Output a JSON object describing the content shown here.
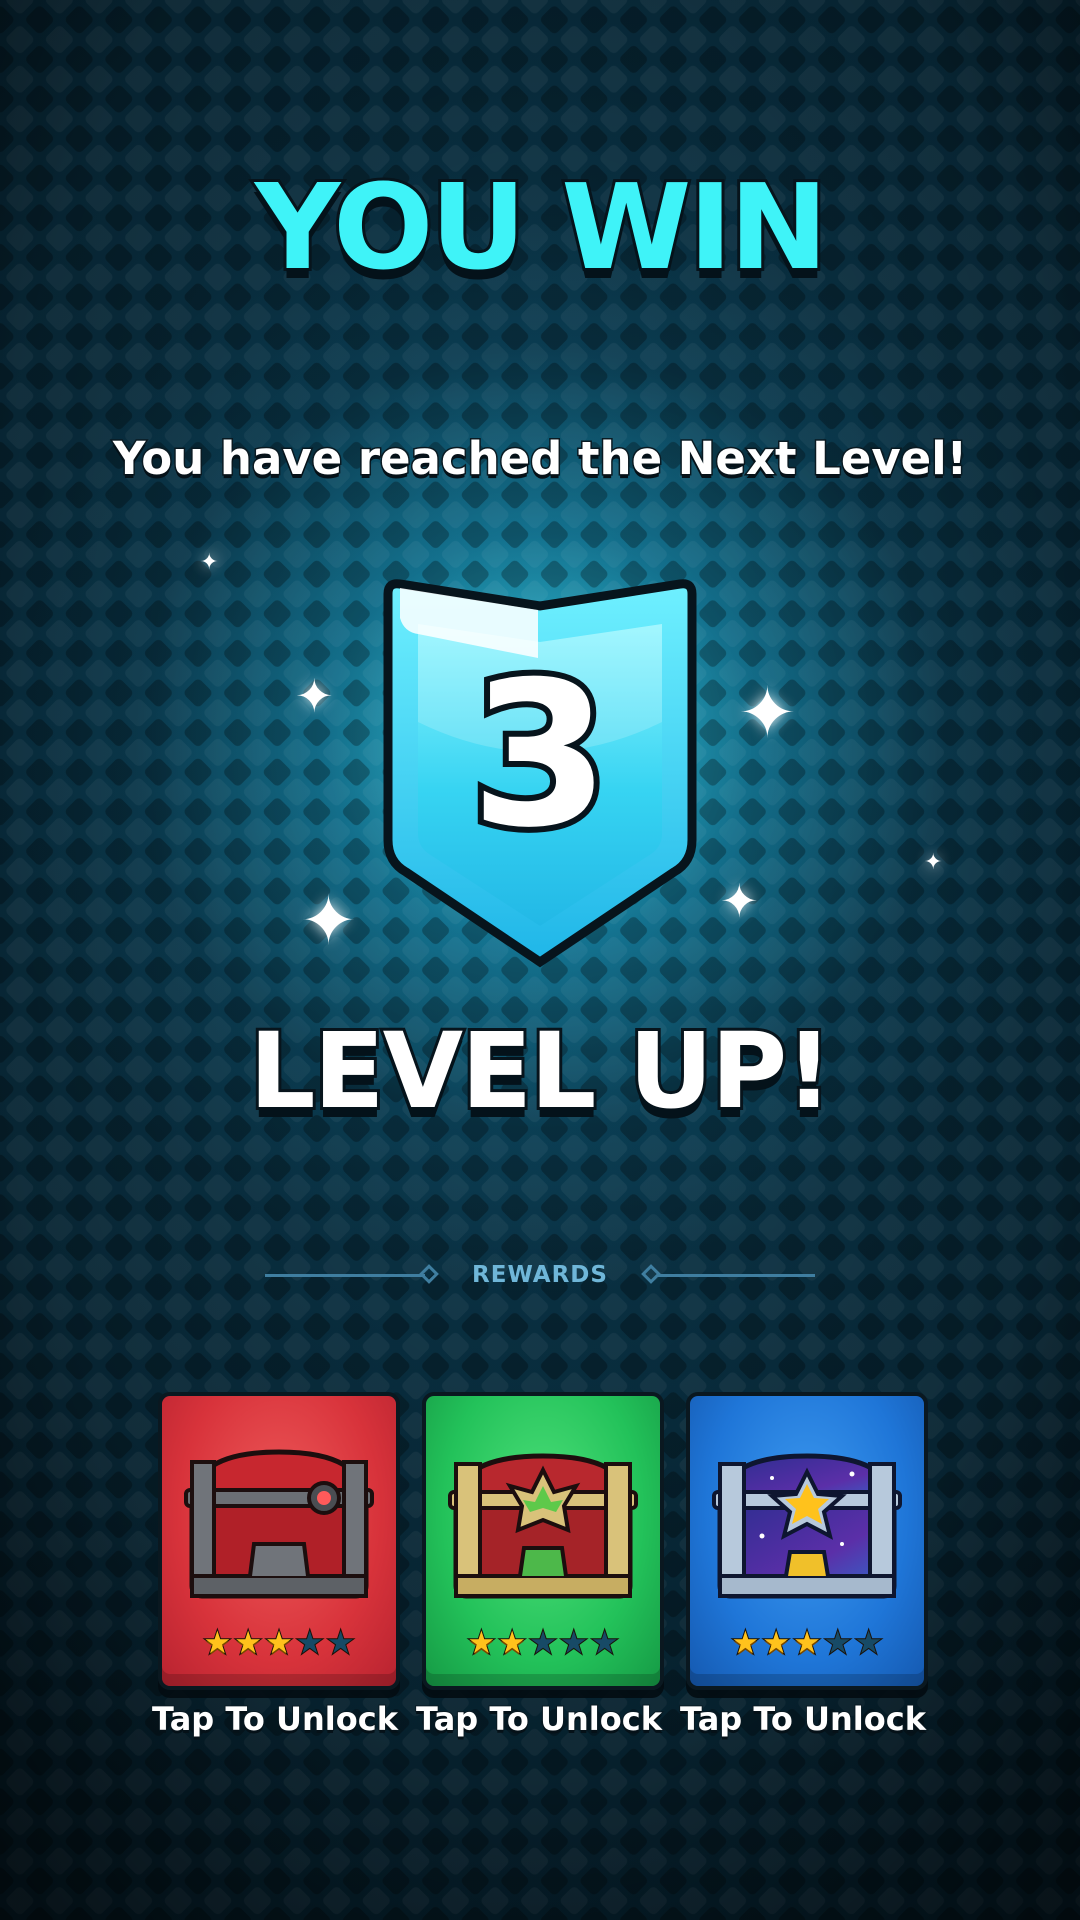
{
  "header": {
    "title": "YOU WIN",
    "subtitle": "You have reached the Next Level!"
  },
  "level": {
    "number": "3",
    "banner": "LEVEL UP!"
  },
  "rewards": {
    "label": "REWARDS",
    "chests": [
      {
        "color": "red",
        "icon": "red-iron-chest-icon",
        "stars": 3,
        "max_stars": 5,
        "caption": "Tap To Unlock"
      },
      {
        "color": "green",
        "icon": "gold-green-chest-icon",
        "stars": 2,
        "max_stars": 5,
        "caption": "Tap To Unlock"
      },
      {
        "color": "blue",
        "icon": "cosmic-star-chest-icon",
        "stars": 3,
        "max_stars": 5,
        "caption": "Tap To Unlock"
      }
    ]
  },
  "colors": {
    "title": "#3ff3f8",
    "badge_light": "#6ff0ff",
    "badge_dark": "#1fb6e8",
    "card_red": "#d8333b",
    "card_green": "#23c25a",
    "card_blue": "#1f76d8",
    "star_on": "#ffc21c",
    "star_off": "#174a66"
  }
}
